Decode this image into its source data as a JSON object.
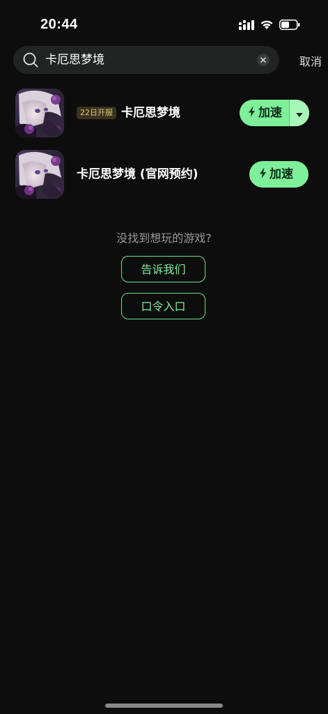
{
  "status_bar": {
    "time": "20:44"
  },
  "search": {
    "query": "卡厄思梦境",
    "cancel_label": "取消"
  },
  "results": [
    {
      "badge": "22日开服",
      "title": "卡厄思梦境",
      "action_label": "加速"
    },
    {
      "badge": "",
      "title": "卡厄思梦境 (官网预约)",
      "action_label": "加速"
    }
  ],
  "not_found": {
    "prompt": "没找到想玩的游戏?",
    "tell_us_label": "告诉我们",
    "code_entry_label": "口令入口"
  },
  "colors": {
    "background": "#0d0d0d",
    "accent_green": "#7ef09a",
    "badge_gold": "#e8c276"
  },
  "icons": {
    "signal": "cellular-signal-icon",
    "wifi": "wifi-icon",
    "battery": "battery-icon",
    "search": "search-icon",
    "clear": "close-icon",
    "bolt": "lightning-bolt-icon",
    "dropdown": "caret-down-icon"
  }
}
